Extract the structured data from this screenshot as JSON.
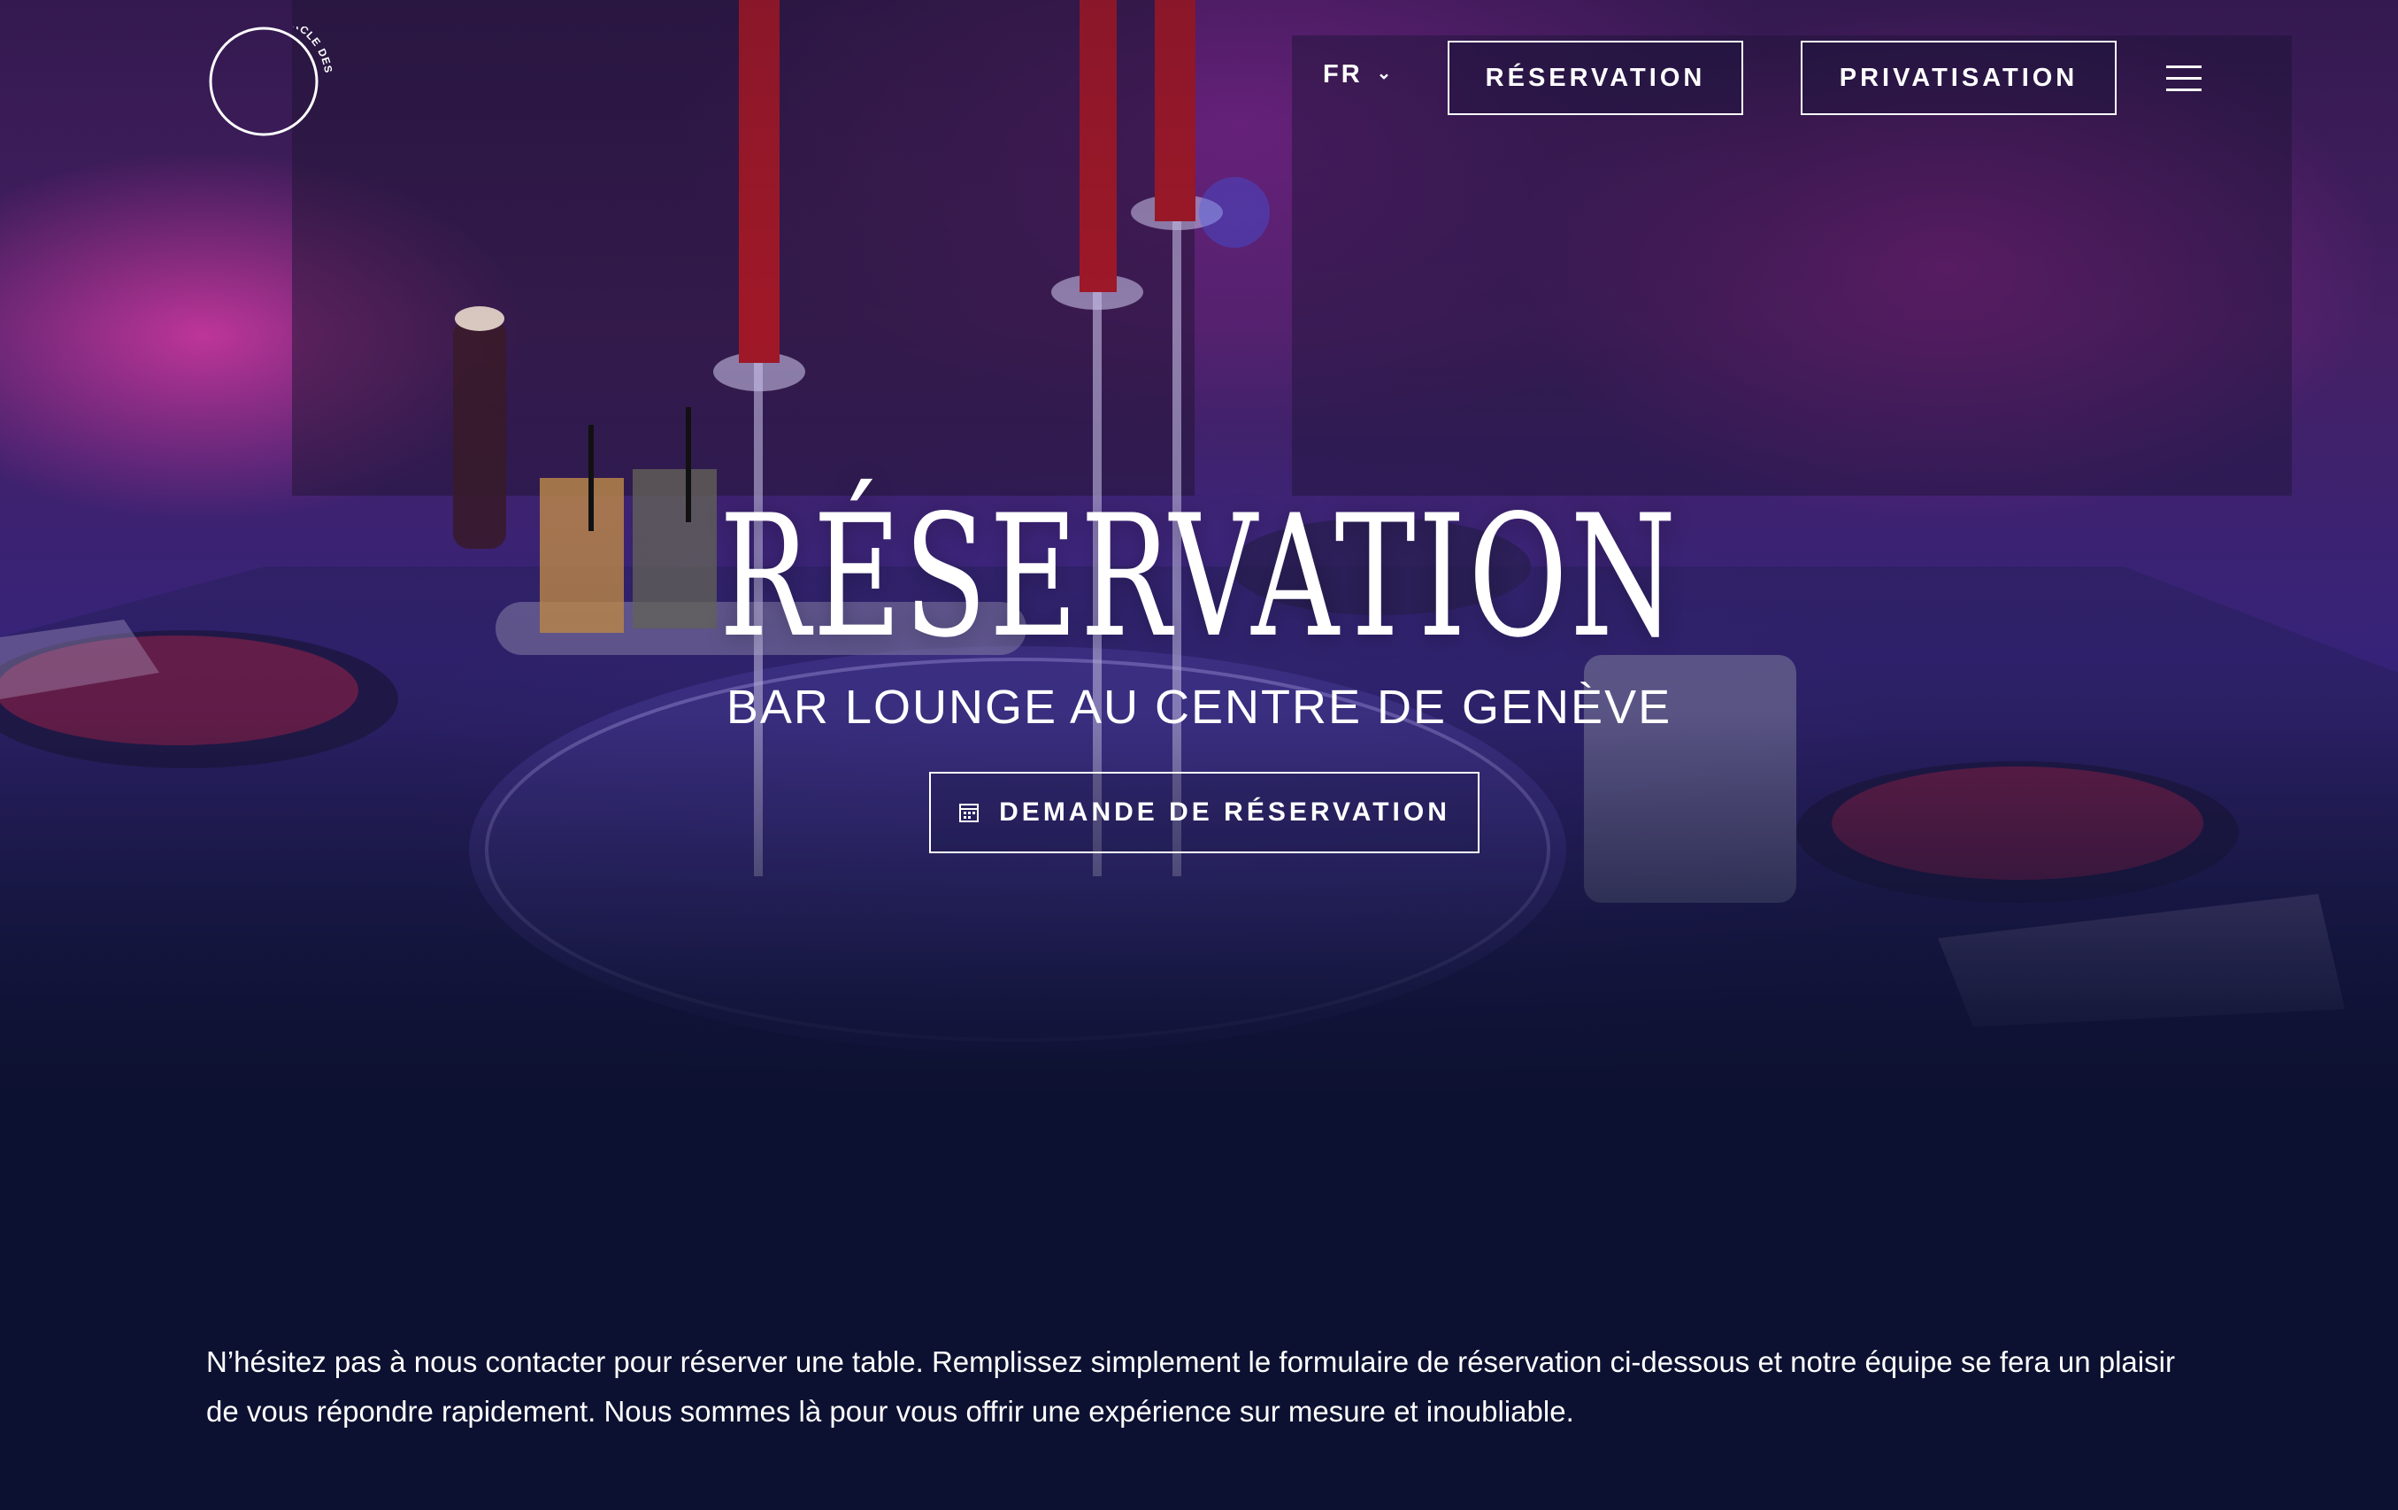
{
  "header": {
    "logo_text": "• CERCLE DES BAINS •",
    "language": "FR",
    "reservation_label": "RÉSERVATION",
    "privatisation_label": "PRIVATISATION"
  },
  "hero": {
    "title": "RÉSERVATION",
    "subtitle": "BAR LOUNGE AU CENTRE DE GENÈVE",
    "cta_label": "DEMANDE DE RÉSERVATION"
  },
  "content": {
    "intro": "N’hésitez pas à nous contacter pour réserver une table. Remplissez simplement le formulaire de réservation ci-dessous et notre équipe se fera un plaisir de vous répondre rapidement. Nous sommes là pour vous offrir une expérience sur mesure et inoubliable."
  },
  "icons": {
    "logo": "logo-circle-icon",
    "language_chevron": "chevron-down-icon",
    "menu": "hamburger-icon",
    "cta": "calendar-icon"
  },
  "colors": {
    "background": "#0d1131",
    "text": "#ffffff",
    "hero_magenta": "#c83aa8",
    "hero_violet": "#3a2580"
  }
}
